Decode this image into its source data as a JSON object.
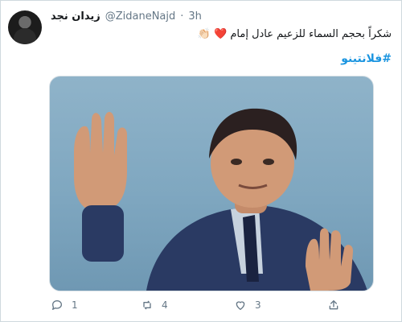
{
  "tweet": {
    "display_name": "زيدان نجد",
    "handle": "@ZidaneNajd",
    "separator": "·",
    "time": "3h",
    "text": "شكراً بحجم السماء للزعيم عادل إمام",
    "hashtag": "#فلانتينو"
  },
  "actions": {
    "reply_count": "1",
    "retweet_count": "4",
    "like_count": "3"
  },
  "colors": {
    "link": "#1b95e0",
    "heart": "#e0245e",
    "muted": "#657786"
  },
  "icons": [
    "avatar",
    "heart-emoji",
    "clap-emoji",
    "reply-icon",
    "retweet-icon",
    "like-icon",
    "share-icon"
  ]
}
